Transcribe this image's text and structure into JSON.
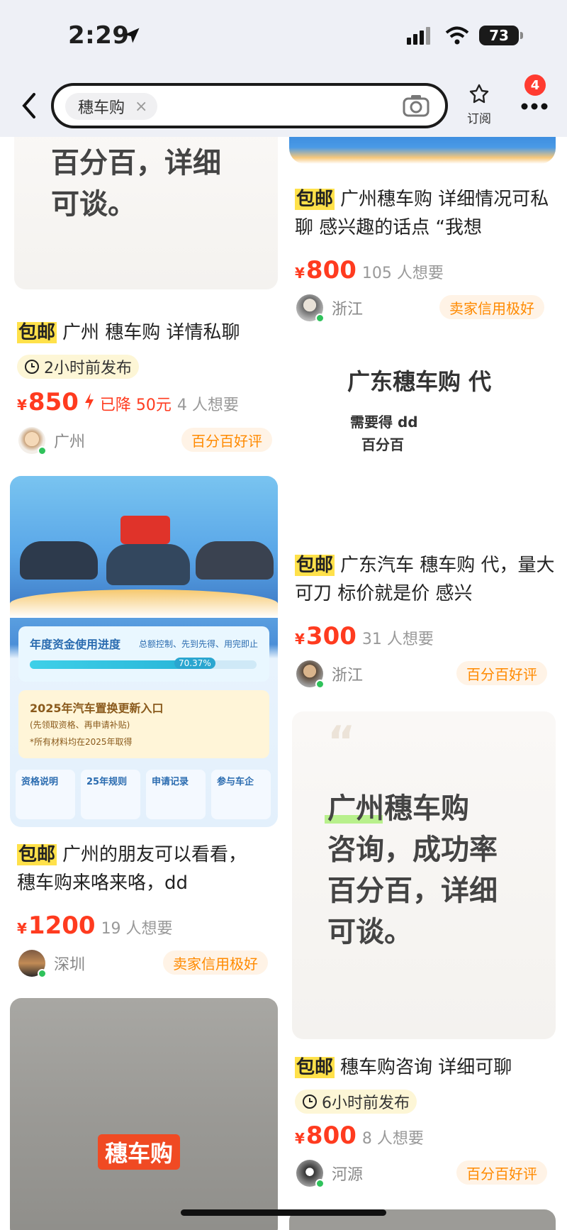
{
  "status": {
    "time": "2:29",
    "battery": "73"
  },
  "nav": {
    "search_chip": "穗车购",
    "chip_close": "×",
    "subscribe_label": "订阅",
    "badge": "4"
  },
  "cards": [
    {
      "image_text": "百分百，详细\n可谈。",
      "tag": "包邮",
      "title": "广州 穗车购 详情私聊",
      "published": "2小时前发布",
      "price": "850",
      "drop": "已降 50元",
      "want": "4 人想要",
      "location": "广州",
      "credit": "百分百好评"
    },
    {
      "tag": "包邮",
      "title": "广州穗车购 详细情况可私聊 感兴趣的话点 “我想",
      "price": "800",
      "want": "105 人想要",
      "location": "浙江",
      "credit": "卖家信用极好"
    },
    {
      "ad_title": "广东穗车购 代",
      "ad_line1": "需要得 dd",
      "ad_line2": "百分百",
      "tag": "包邮",
      "title": "广东汽车 穗车购 代，量大可刀 标价就是价 感兴",
      "price": "300",
      "want": "31 人想要",
      "location": "浙江",
      "credit": "百分百好评"
    },
    {
      "poster": {
        "progress_title": "年度资金使用进度",
        "progress_sub": "总额控制、先到先得、用完即止",
        "progress_value": "70.37%",
        "progress_fraction": 0.7037,
        "entry_title": "2025年汽车置换更新入口",
        "entry_sub1": "(先领取资格、再申请补贴)",
        "entry_sub2": "*所有材料均在2025年取得",
        "tabs": [
          "资格说明",
          "25年规则",
          "申请记录",
          "参与车企"
        ]
      },
      "tag": "包邮",
      "title": "广州的朋友可以看看，穗车购来咯来咯，dd",
      "price": "1200",
      "want": "19 人想要",
      "location": "深圳",
      "credit": "卖家信用极好"
    },
    {
      "image_text": "广州穗车购\n咨询，成功率\n百分百，详细\n可谈。",
      "tag": "包邮",
      "title": "穗车购咨询 详细可聊",
      "published": "6小时前发布",
      "price": "800",
      "want": "8 人想要",
      "location": "河源",
      "credit": "百分百好评"
    },
    {
      "image_text": "穗车购"
    }
  ],
  "currency": "¥",
  "colors": {
    "accent_red": "#ff3b1f",
    "tag_yellow": "#ffe14a",
    "credit_orange": "#ff8a00"
  }
}
